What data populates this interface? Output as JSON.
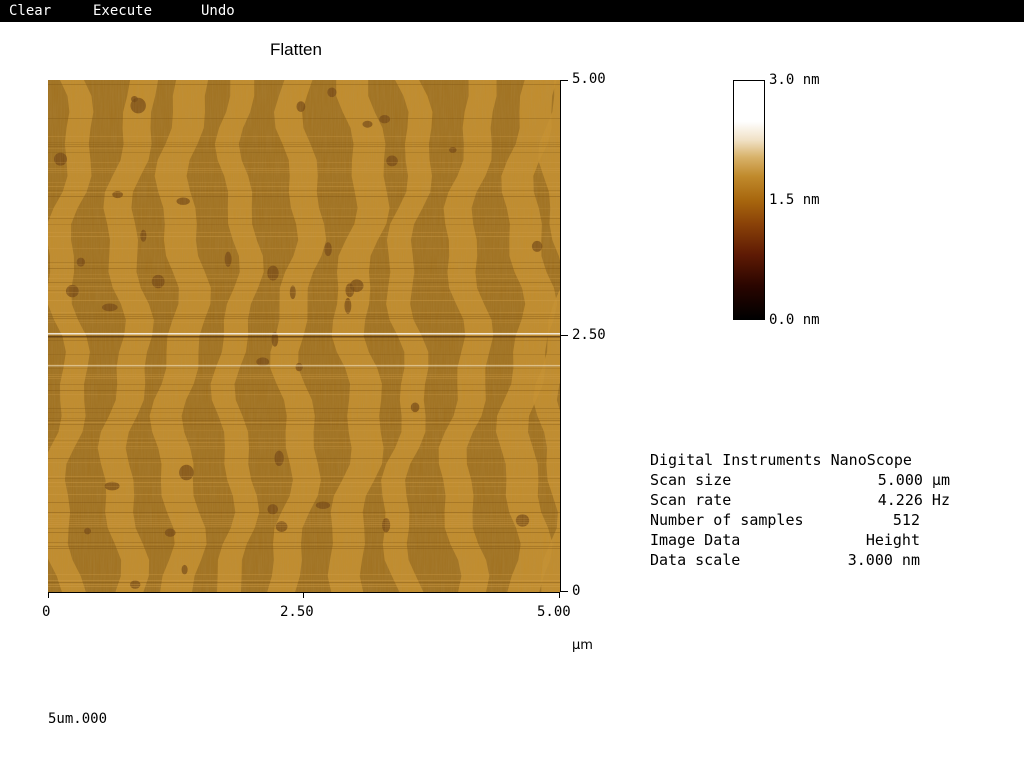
{
  "menu": {
    "items": [
      "Clear",
      "Execute",
      "Undo"
    ]
  },
  "image": {
    "title": "Flatten",
    "y_ticks": {
      "top": "5.00",
      "mid": "2.50",
      "bottom": "0"
    },
    "x_ticks": {
      "left": "0",
      "mid": "2.50",
      "right": "5.00"
    },
    "x_unit": "µm",
    "colors": {
      "base": "#a0701e",
      "terrace_light": "#c8902e",
      "pit_dark": "#6e4010"
    }
  },
  "colorbar": {
    "max_label": "3.0 nm",
    "mid_label": "1.5 nm",
    "min_label": "0.0 nm"
  },
  "info": {
    "header": "Digital Instruments NanoScope",
    "rows": [
      {
        "key": "Scan size",
        "value": "5.000 µm"
      },
      {
        "key": "Scan rate",
        "value": "4.226 Hz"
      },
      {
        "key": "Number of samples",
        "value": "512"
      },
      {
        "key": "Image Data",
        "value": "Height"
      },
      {
        "key": "Data scale",
        "value": "3.000 nm"
      }
    ]
  },
  "filename": "5um.000"
}
